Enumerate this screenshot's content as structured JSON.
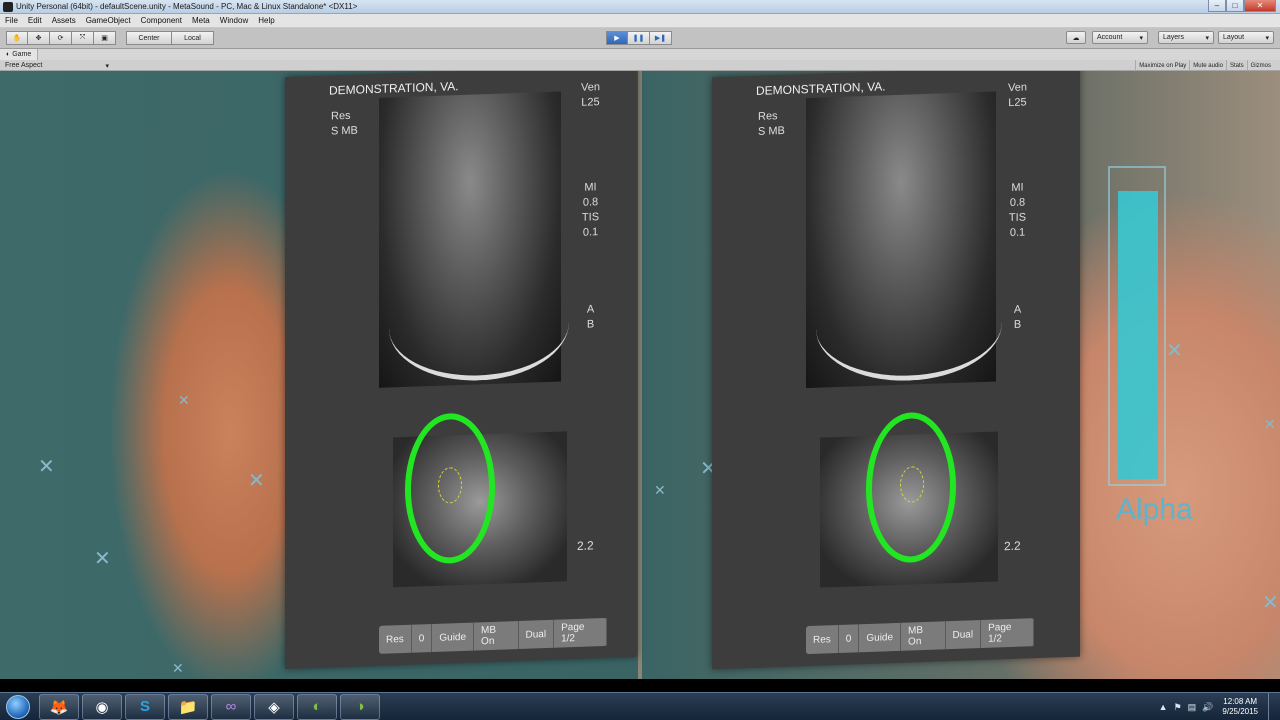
{
  "window": {
    "title": "Unity Personal (64bit) - defaultScene.unity - MetaSound - PC, Mac & Linux Standalone* <DX11>",
    "controls": {
      "minimize": "–",
      "maximize": "□",
      "close": "✕"
    }
  },
  "menu": [
    "File",
    "Edit",
    "Assets",
    "GameObject",
    "Component",
    "Meta",
    "Window",
    "Help"
  ],
  "toolbar": {
    "tools": [
      {
        "name": "hand-tool",
        "glyph": "✋"
      },
      {
        "name": "move-tool",
        "glyph": "✥"
      },
      {
        "name": "rotate-tool",
        "glyph": "⟳"
      },
      {
        "name": "scale-tool",
        "glyph": "⤧"
      },
      {
        "name": "rect-tool",
        "glyph": "▣"
      }
    ],
    "pivot": "Center",
    "space": "Local",
    "play_glyph": "▶",
    "pause_glyph": "❚❚",
    "step_glyph": "▶❚",
    "cloud_glyph": "☁",
    "account": "Account",
    "layers": "Layers",
    "layout": "Layout",
    "play_active": true
  },
  "game_panel": {
    "tab_label": "Game",
    "aspect": "Free Aspect",
    "options": [
      "Maximize on Play",
      "Mute audio",
      "Stats",
      "Gizmos"
    ]
  },
  "monitor": {
    "header": "DEMONSTRATION, VA.",
    "left_labels": [
      "Res",
      "S   MB"
    ],
    "right_labels": [
      "Ven",
      "L25",
      "MI",
      "0.8",
      "TIS",
      "0.1"
    ],
    "side_letters": [
      "A",
      "B"
    ],
    "scale_value": "2.2",
    "footer": [
      "Res",
      "0",
      "Guide",
      "MB On",
      "Dual",
      "Page 1/2"
    ]
  },
  "alpha": {
    "label": "Alpha",
    "level": 0.96,
    "color": "#3ac5cf"
  },
  "taskbar": {
    "apps": [
      {
        "name": "firefox-app",
        "glyph": "🦊"
      },
      {
        "name": "chrome-app",
        "glyph": "◉"
      },
      {
        "name": "skype-app",
        "glyph": "S"
      },
      {
        "name": "explorer-app",
        "glyph": "📁"
      },
      {
        "name": "visual-studio-app",
        "glyph": "∞"
      },
      {
        "name": "unity-app",
        "glyph": "◈"
      },
      {
        "name": "nvidia-app",
        "glyph": "◐"
      },
      {
        "name": "nvidia-app-2",
        "glyph": "◑"
      }
    ],
    "time": "12:08 AM",
    "date": "9/25/2015"
  }
}
